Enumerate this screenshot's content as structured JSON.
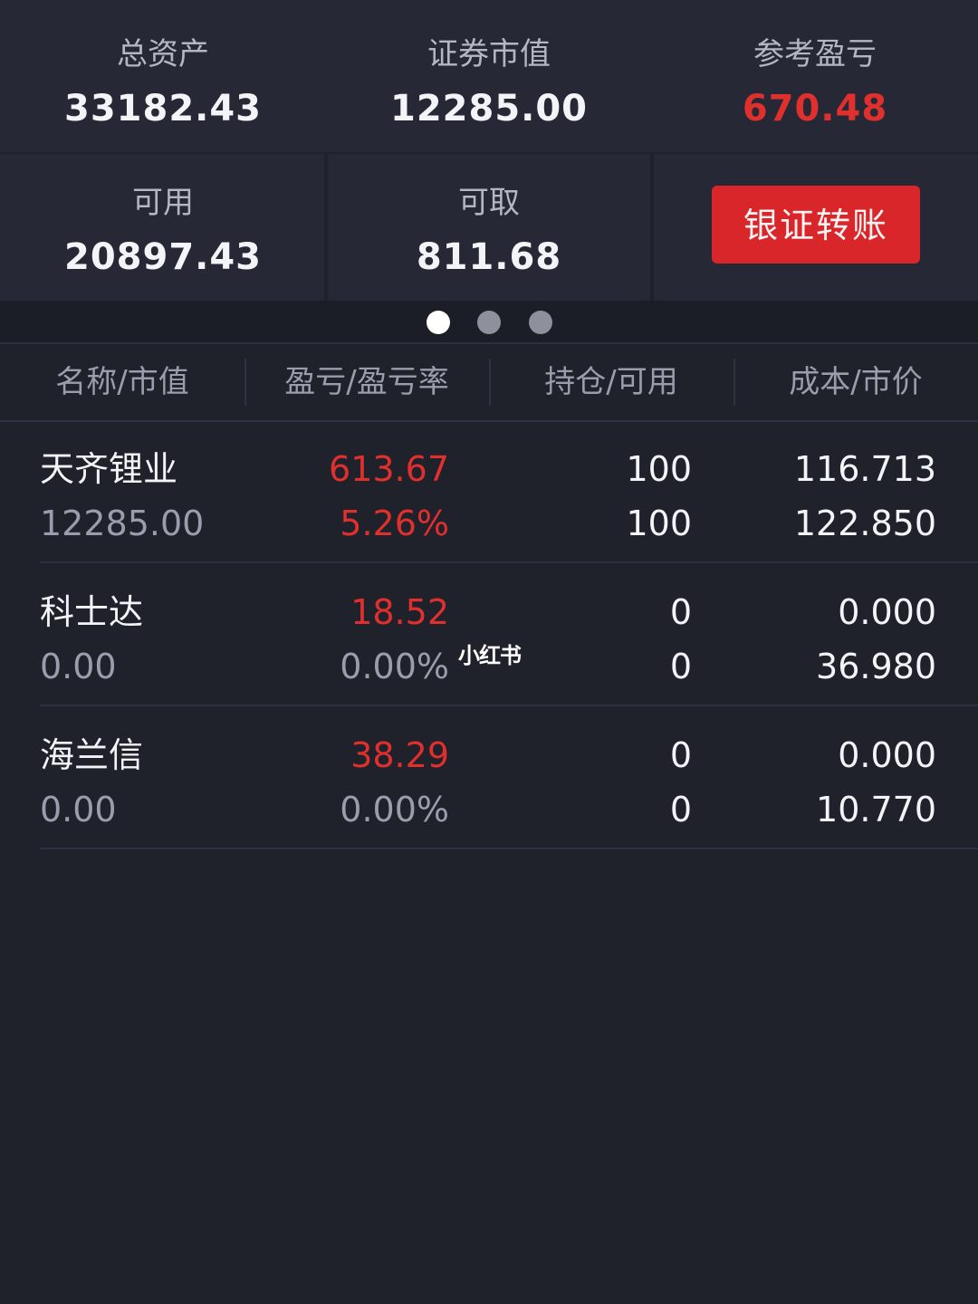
{
  "summary": {
    "total_assets_label": "总资产",
    "total_assets": "33182.43",
    "market_value_label": "证券市值",
    "market_value": "12285.00",
    "ref_pnl_label": "参考盈亏",
    "ref_pnl": "670.48",
    "available_label": "可用",
    "available": "20897.43",
    "withdrawable_label": "可取",
    "withdrawable": "811.68",
    "transfer_button": "银证转账"
  },
  "pager": {
    "count": 3,
    "active_index": 0
  },
  "table": {
    "headers": [
      "名称/市值",
      "盈亏/盈亏率",
      "持仓/可用",
      "成本/市价"
    ],
    "rows": [
      {
        "name": "天齐锂业",
        "market_value": "12285.00",
        "pnl": "613.67",
        "pnl_rate": "5.26%",
        "position": "100",
        "available": "100",
        "cost": "116.713",
        "price": "122.850",
        "rate_color": "red"
      },
      {
        "name": "科士达",
        "market_value": "0.00",
        "pnl": "18.52",
        "pnl_rate": "0.00%",
        "position": "0",
        "available": "0",
        "cost": "0.000",
        "price": "36.980",
        "rate_color": "gray"
      },
      {
        "name": "海兰信",
        "market_value": "0.00",
        "pnl": "38.29",
        "pnl_rate": "0.00%",
        "position": "0",
        "available": "0",
        "cost": "0.000",
        "price": "10.770",
        "rate_color": "gray"
      }
    ]
  },
  "watermark": "小红书",
  "colors": {
    "background": "#1f212b",
    "panel": "#262935",
    "accent_red": "#e0302e",
    "button_red": "#d9262a"
  }
}
